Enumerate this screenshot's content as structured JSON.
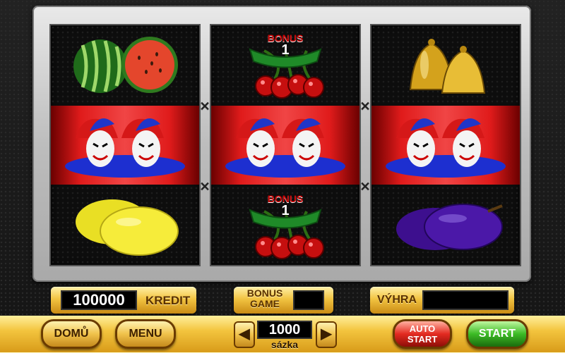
{
  "reels": [
    {
      "symbols": [
        "watermelon",
        "joker",
        "lemon"
      ]
    },
    {
      "symbols": [
        "bonus-cherries",
        "joker",
        "bonus-cherries"
      ]
    },
    {
      "symbols": [
        "bells",
        "joker",
        "plum"
      ]
    }
  ],
  "bonus_badge": {
    "title": "BONUS",
    "value": "1"
  },
  "panel": {
    "credit_value": "100000",
    "credit_label": "KREDIT",
    "bonus_game_label_1": "BONUS",
    "bonus_game_label_2": "GAME",
    "bonus_game_value": "",
    "win_label": "VÝHRA",
    "win_value": ""
  },
  "controls": {
    "home_label": "DOMŮ",
    "menu_label": "MENU",
    "bet_value": "1000",
    "bet_label": "sázka",
    "bet_decrease_glyph": "◀",
    "bet_increase_glyph": "▶",
    "autostart_label_1": "AUTO",
    "autostart_label_2": "START",
    "start_label": "START"
  },
  "colors": {
    "win_row": "#e01b1b",
    "gold": "#f2c442",
    "start_green": "#3cbb25",
    "auto_red": "#e32a20"
  }
}
